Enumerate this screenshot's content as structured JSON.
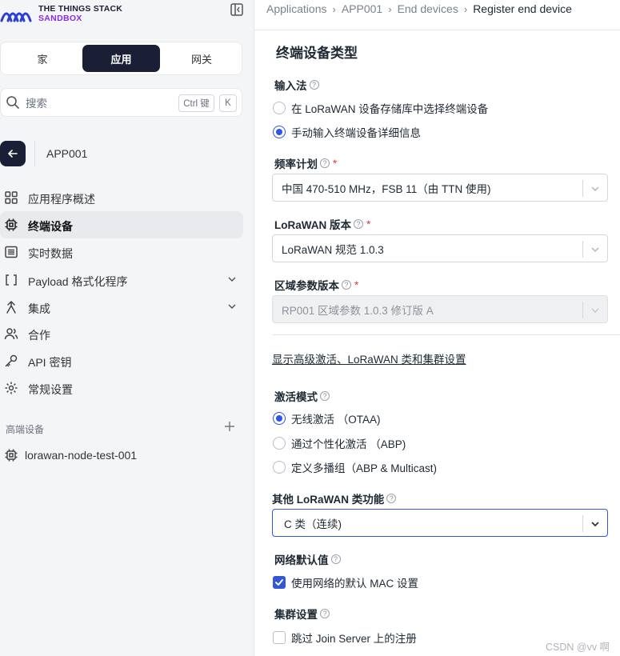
{
  "brand": {
    "line1": "THE THINGS STACK",
    "line2": "SANDBOX"
  },
  "tabs": [
    {
      "label": "家"
    },
    {
      "label": "应用"
    },
    {
      "label": "网关"
    }
  ],
  "search": {
    "placeholder": "搜索",
    "shortcut_ctrl": "Ctrl 键",
    "shortcut_key": "K"
  },
  "app": {
    "name": "APP001"
  },
  "nav": [
    {
      "label": "应用程序概述",
      "icon": "overview-grid-icon"
    },
    {
      "label": "终端设备",
      "icon": "chip-icon"
    },
    {
      "label": "实时数据",
      "icon": "list-icon"
    },
    {
      "label": "Payload 格式化程序",
      "icon": "code-brackets-icon"
    },
    {
      "label": "集成",
      "icon": "integration-icon"
    },
    {
      "label": "合作",
      "icon": "people-icon"
    },
    {
      "label": "API 密钥",
      "icon": "key-icon"
    },
    {
      "label": "常规设置",
      "icon": "gear-icon"
    }
  ],
  "pinned": {
    "title": "高端设备",
    "device": "lorawan-node-test-001"
  },
  "breadcrumb": [
    "Applications",
    "APP001",
    "End devices",
    "Register end device"
  ],
  "form": {
    "title": "终端设备类型",
    "input_method": {
      "label": "输入法",
      "options": [
        "在 LoRaWAN 设备存储库中选择终端设备",
        "手动输入终端设备详细信息"
      ],
      "selected_index": 1
    },
    "frequency_plan": {
      "label": "频率计划",
      "value": "中国 470-510 MHz，FSB 11（由 TTN 使用)"
    },
    "lorawan_version": {
      "label": "LoRaWAN 版本",
      "value": "LoRaWAN 规范 1.0.3"
    },
    "regional_params": {
      "label": "区域参数版本",
      "value": "RP001 区域参数 1.0.3 修订版 A"
    },
    "advanced_link": "显示高级激活、LoRaWAN 类和集群设置",
    "activation_mode": {
      "label": "激活模式",
      "options": [
        "无线激活 （OTAA)",
        "通过个性化激活 （ABP)",
        "定义多播组（ABP & Multicast)"
      ],
      "selected_index": 0
    },
    "class_capabilities": {
      "label": "其他 LoRaWAN 类功能",
      "value": "C 类（连续)"
    },
    "network_defaults": {
      "label": "网络默认值",
      "checkbox": "使用网络的默认 MAC 设置",
      "checked": true
    },
    "cluster_settings": {
      "label": "集群设置",
      "checkbox": "跳过 Join Server 上的注册",
      "checked": false
    }
  },
  "watermark": "CSDN @vv 啊",
  "colors": {
    "accent": "#3457d5",
    "dark": "#1a1f36",
    "required": "#d63b3b",
    "brand_purple": "#8b2be2"
  }
}
